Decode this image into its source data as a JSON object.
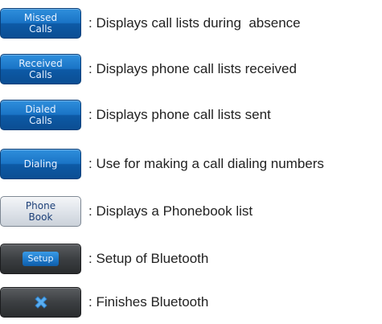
{
  "items": [
    {
      "button_label": "Missed\nCalls",
      "description": ": Displays call lists during  absence"
    },
    {
      "button_label": "Received\nCalls",
      "description": ": Displays phone call lists received"
    },
    {
      "button_label": "Dialed\nCalls",
      "description": ": Displays phone call lists sent"
    },
    {
      "button_label": "Dialing",
      "description": ": Use for making a call dialing numbers"
    },
    {
      "button_label": "Phone\nBook",
      "description": ": Displays a Phonebook list"
    },
    {
      "button_label": "Setup",
      "description": ": Setup of Bluetooth"
    },
    {
      "button_icon": "close-icon",
      "description": ": Finishes Bluetooth"
    }
  ],
  "colors": {
    "button_blue": "#1a74c6",
    "button_silver": "#dfe4ea",
    "button_dark": "#3c3f42",
    "close_icon": "#5aaef0"
  }
}
